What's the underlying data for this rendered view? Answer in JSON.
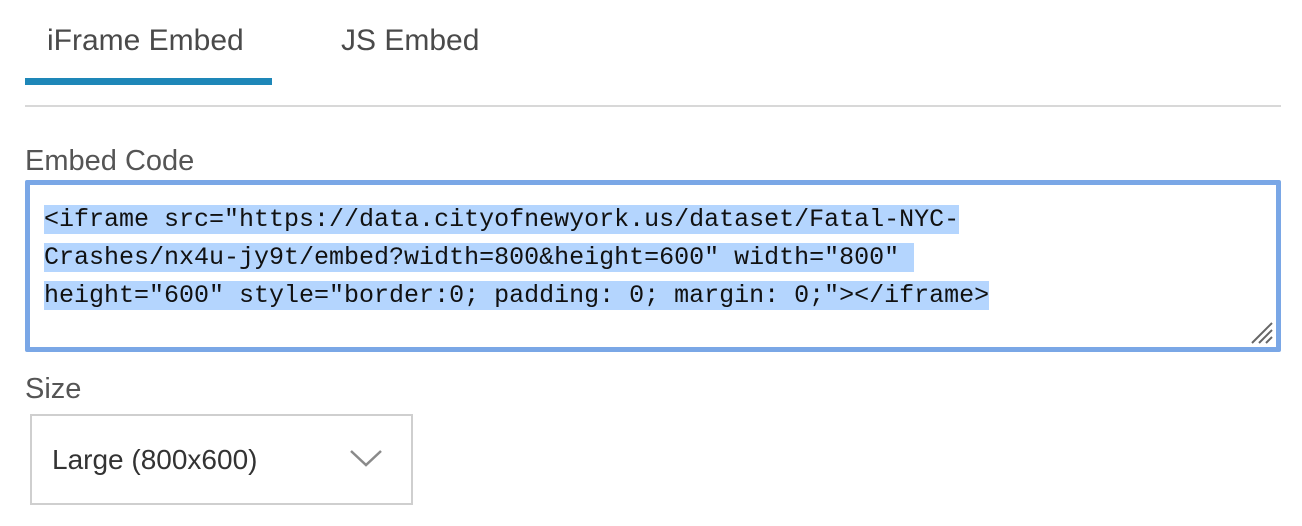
{
  "tabs": {
    "iframe_label": "iFrame Embed",
    "js_label": "JS Embed",
    "active": "iframe"
  },
  "embed": {
    "label": "Embed Code",
    "code_lines": [
      "<iframe src=\"https://data.cityofnewyork.us/dataset/Fatal-NYC-",
      "Crashes/nx4u-jy9t/embed?width=800&height=600\" width=\"800\" ",
      "height=\"600\" style=\"border:0; padding: 0; margin: 0;\"></iframe>"
    ],
    "selected": true
  },
  "size": {
    "label": "Size",
    "selected_value": "Large (800x600)"
  },
  "icons": {
    "chevron": "chevron-down-icon",
    "resize": "resize-grip-icon"
  },
  "colors": {
    "accent": "#1e87b8",
    "focus_border": "#7aa7e6",
    "selection": "#b4d5fe"
  }
}
